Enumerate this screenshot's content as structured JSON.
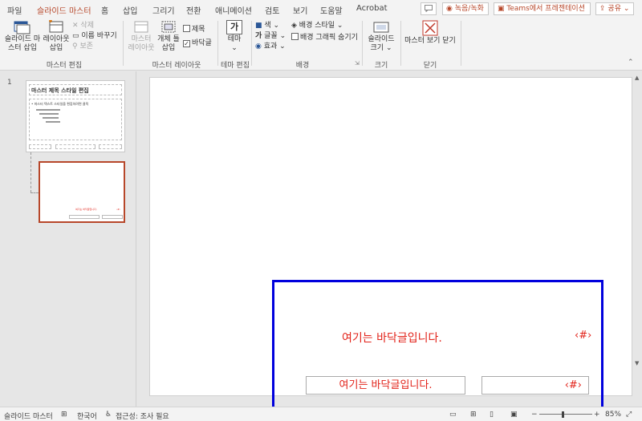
{
  "tabs": [
    {
      "label": "파일"
    },
    {
      "label": "슬라이드 마스터"
    },
    {
      "label": "홈"
    },
    {
      "label": "삽입"
    },
    {
      "label": "그리기"
    },
    {
      "label": "전환"
    },
    {
      "label": "애니메이션"
    },
    {
      "label": "검토"
    },
    {
      "label": "보기"
    },
    {
      "label": "도움말"
    },
    {
      "label": "Acrobat"
    }
  ],
  "topbar": {
    "record_label": "녹음/녹화",
    "teams_label": "Teams에서 프레젠테이션",
    "share_label": "공유"
  },
  "ribbon": {
    "insert_master_line1": "슬라이드 마",
    "insert_master_line2": "스터 삽입",
    "insert_layout_line1": "레이아웃",
    "insert_layout_line2": "삽입",
    "delete": "삭제",
    "rename": "이름 바꾸기",
    "preserve": "보존",
    "group_master_edit": "마스터 편집",
    "master_layout_line1": "마스터",
    "master_layout_line2": "레이아웃",
    "insert_placeholder_line1": "개체 틀",
    "insert_placeholder_line2": "삽입",
    "title_check": "제목",
    "footer_check": "바닥글",
    "group_master_layout": "마스터 레이아웃",
    "theme_label": "테마",
    "theme_glyph": "가",
    "group_theme_edit": "테마 편집",
    "colors": "색",
    "fonts": "글꼴",
    "effects": "효과",
    "bg_styles": "배경 스타일",
    "hide_bg": "배경 그래픽 숨기기",
    "group_background": "배경",
    "slide_size_line1": "슬라이드",
    "slide_size_line2": "크기",
    "group_size": "크기",
    "close_master": "마스터 보기 닫기",
    "group_close": "닫기"
  },
  "thumbs": {
    "number": "1",
    "master_title": "마스터 제목 스타일 편집",
    "master_body": "• 마스터 텍스트 스타일을 편집하려면 클릭"
  },
  "slide": {
    "footer_text": "여기는 바닥글입니다.",
    "slide_number": "‹#›",
    "footer_box_text": "여기는 바닥글입니다.",
    "number_box_text": "‹#›"
  },
  "status": {
    "view": "슬라이드 마스터",
    "language": "한국어",
    "accessibility": "접근성: 조사 필요",
    "zoom": "85%"
  },
  "colors": {
    "accent": "#b7472a",
    "highlight": "#0000dd",
    "footer_red": "#e2231a"
  }
}
